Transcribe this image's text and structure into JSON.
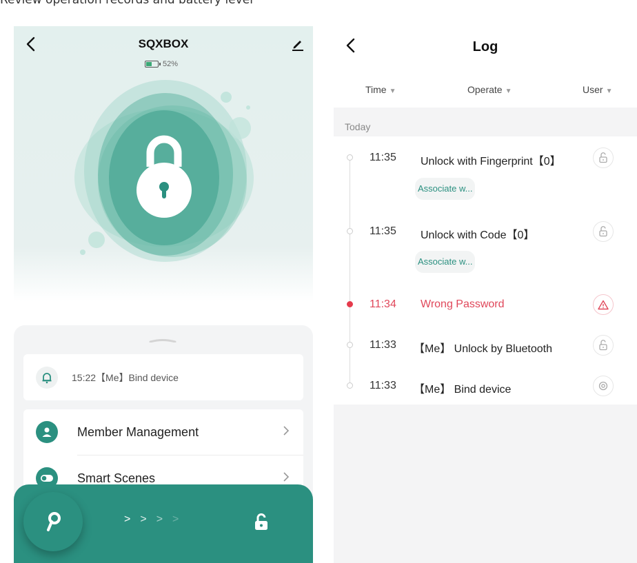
{
  "caption": "Review operation records and battery level",
  "device": {
    "title": "SQXBOX",
    "battery_level": 0.52,
    "battery_text": "52%"
  },
  "recent": {
    "text": "15:22【Me】Bind device",
    "icon": "bell-icon"
  },
  "menu": [
    {
      "label": "Member Management",
      "icon": "user-icon"
    },
    {
      "label": "Smart Scenes",
      "icon": "toggle-icon"
    }
  ],
  "slider": {
    "arrows": [
      ">",
      ">",
      ">",
      ">"
    ]
  },
  "log": {
    "title": "Log",
    "filters": {
      "time": "Time",
      "operate": "Operate",
      "user": "User"
    },
    "group": "Today",
    "entries": [
      {
        "time": "11:35",
        "label": "Unlock with Fingerprint【0】",
        "icon": "unlock-icon",
        "associate": "Associate w..."
      },
      {
        "time": "11:35",
        "label": "Unlock with Code【0】",
        "icon": "unlock-icon",
        "associate": "Associate w..."
      },
      {
        "time": "11:34",
        "label": "Wrong Password",
        "icon": "warning-icon",
        "status": "error"
      },
      {
        "time": "11:33",
        "label": "【Me】 Unlock by Bluetooth",
        "icon": "unlock-icon"
      },
      {
        "time": "11:33",
        "label": "【Me】 Bind device",
        "icon": "bind-icon"
      }
    ]
  },
  "colors": {
    "accent": "#2b9080",
    "hero_bg": "#e3f0ee",
    "error": "#e0475a",
    "battery": "#3aa875"
  }
}
